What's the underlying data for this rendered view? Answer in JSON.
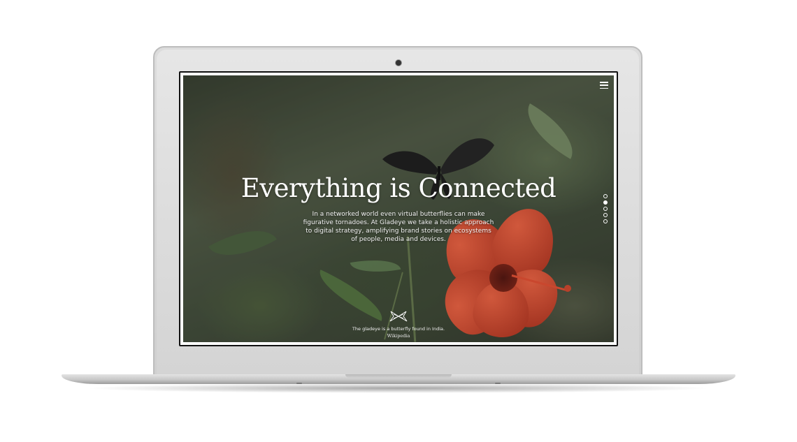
{
  "device": {
    "type": "laptop-mockup"
  },
  "site": {
    "hero": {
      "title": "Everything is Connected",
      "body": "In a networked world even virtual butterflies can make figurative tornadoes. At Gladeye we take a holistic approach to digital strategy, amplifying brand stories on ecosystems of people, media and devices."
    },
    "menu": {
      "icon": "hamburger-menu-icon"
    },
    "pagination": {
      "count": 5,
      "active_index": 1
    },
    "footer": {
      "logo_icon": "butterfly-logo-icon",
      "caption": "The gladeye is a butterfly found in India.",
      "link": "Wikipedia"
    }
  }
}
